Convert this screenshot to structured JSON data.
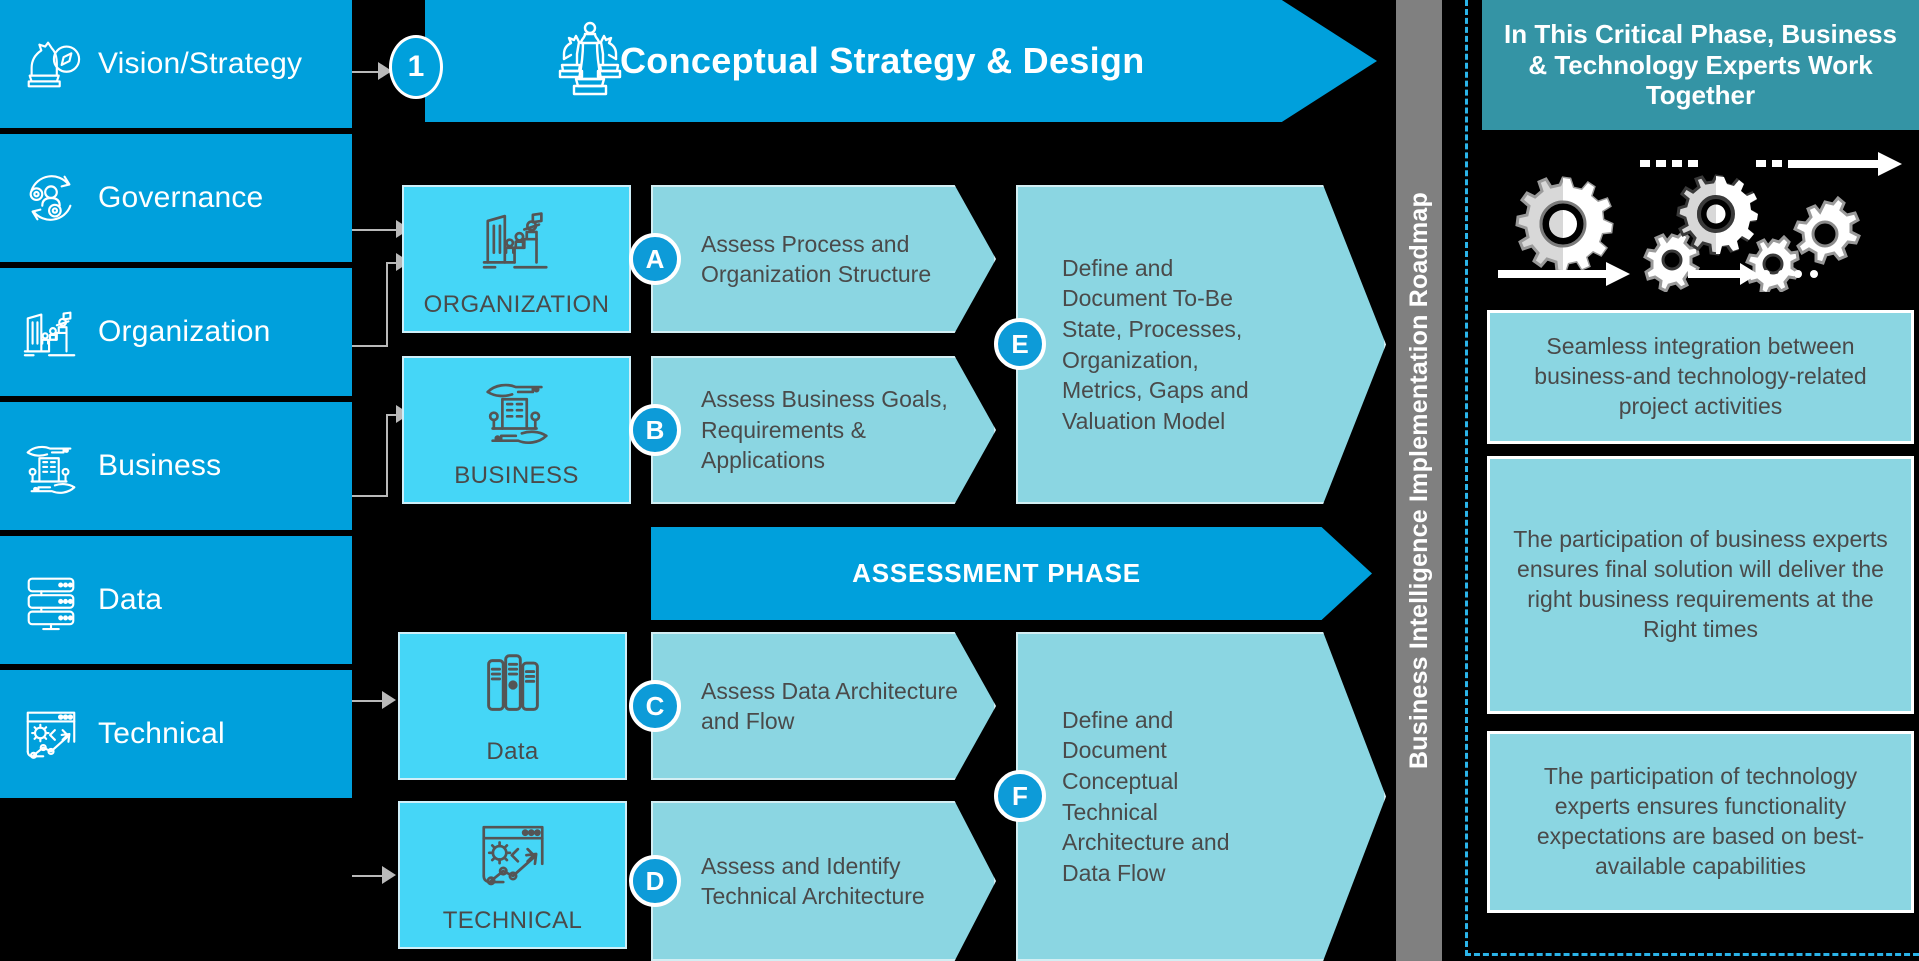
{
  "sidebar": {
    "items": [
      {
        "label": "Vision/Strategy",
        "icon": "chess-knight-compass-icon"
      },
      {
        "label": "Governance",
        "icon": "governance-cycle-icon"
      },
      {
        "label": "Organization",
        "icon": "organization-building-icon"
      },
      {
        "label": "Business",
        "icon": "business-hands-building-icon"
      },
      {
        "label": "Data",
        "icon": "data-server-icon"
      },
      {
        "label": "Technical",
        "icon": "technical-browser-gear-icon"
      }
    ]
  },
  "phase1": {
    "number": "1",
    "title": "Conceptual Strategy & Design",
    "icon": "chess-pieces-icon"
  },
  "domains": [
    {
      "name": "ORGANIZATION",
      "icon": "organization-building-icon"
    },
    {
      "name": "BUSINESS",
      "icon": "business-hands-building-icon"
    },
    {
      "name": "Data",
      "icon": "data-server-icon"
    },
    {
      "name": "TECHNICAL",
      "icon": "technical-browser-gear-icon"
    }
  ],
  "assessments": [
    {
      "badge": "A",
      "text": "Assess Process and Organization Structure"
    },
    {
      "badge": "B",
      "text": "Assess Business Goals, Requirements & Applications"
    },
    {
      "badge": "C",
      "text": "Assess Data Architecture and Flow"
    },
    {
      "badge": "D",
      "text": "Assess and Identify Technical Architecture"
    }
  ],
  "defines": [
    {
      "badge": "E",
      "text": "Define and Document To-Be State, Processes, Organization, Metrics, Gaps and Valuation Model"
    },
    {
      "badge": "F",
      "text": "Define and Document Conceptual Technical Architecture and Data Flow"
    }
  ],
  "assessment_phase": {
    "label": "ASSESSMENT PHASE"
  },
  "vertical_bar": {
    "label": "Business Intelligence Implementation Roadmap"
  },
  "right_panel": {
    "heading": "In This Critical Phase, Business & Technology Experts Work Together",
    "gears_icon": "gears-process-icon",
    "notes": [
      "Seamless integration between business-and technology-related project activities",
      "The participation of business experts ensures final solution will deliver the right business requirements at the Right times",
      "The participation of technology experts ensures functionality expectations are based on best-available capabilities"
    ]
  },
  "colors": {
    "background": "#000000",
    "primary_blue": "#00A0DC",
    "light_blue": "#45D6F7",
    "pale_teal": "#8BD6E2",
    "teal_header": "#3494A5",
    "gray_bar": "#808080",
    "badge_blue": "#0D9BD8",
    "connector_gray": "#B9B9B9",
    "dash_border": "#2BB3E8"
  }
}
